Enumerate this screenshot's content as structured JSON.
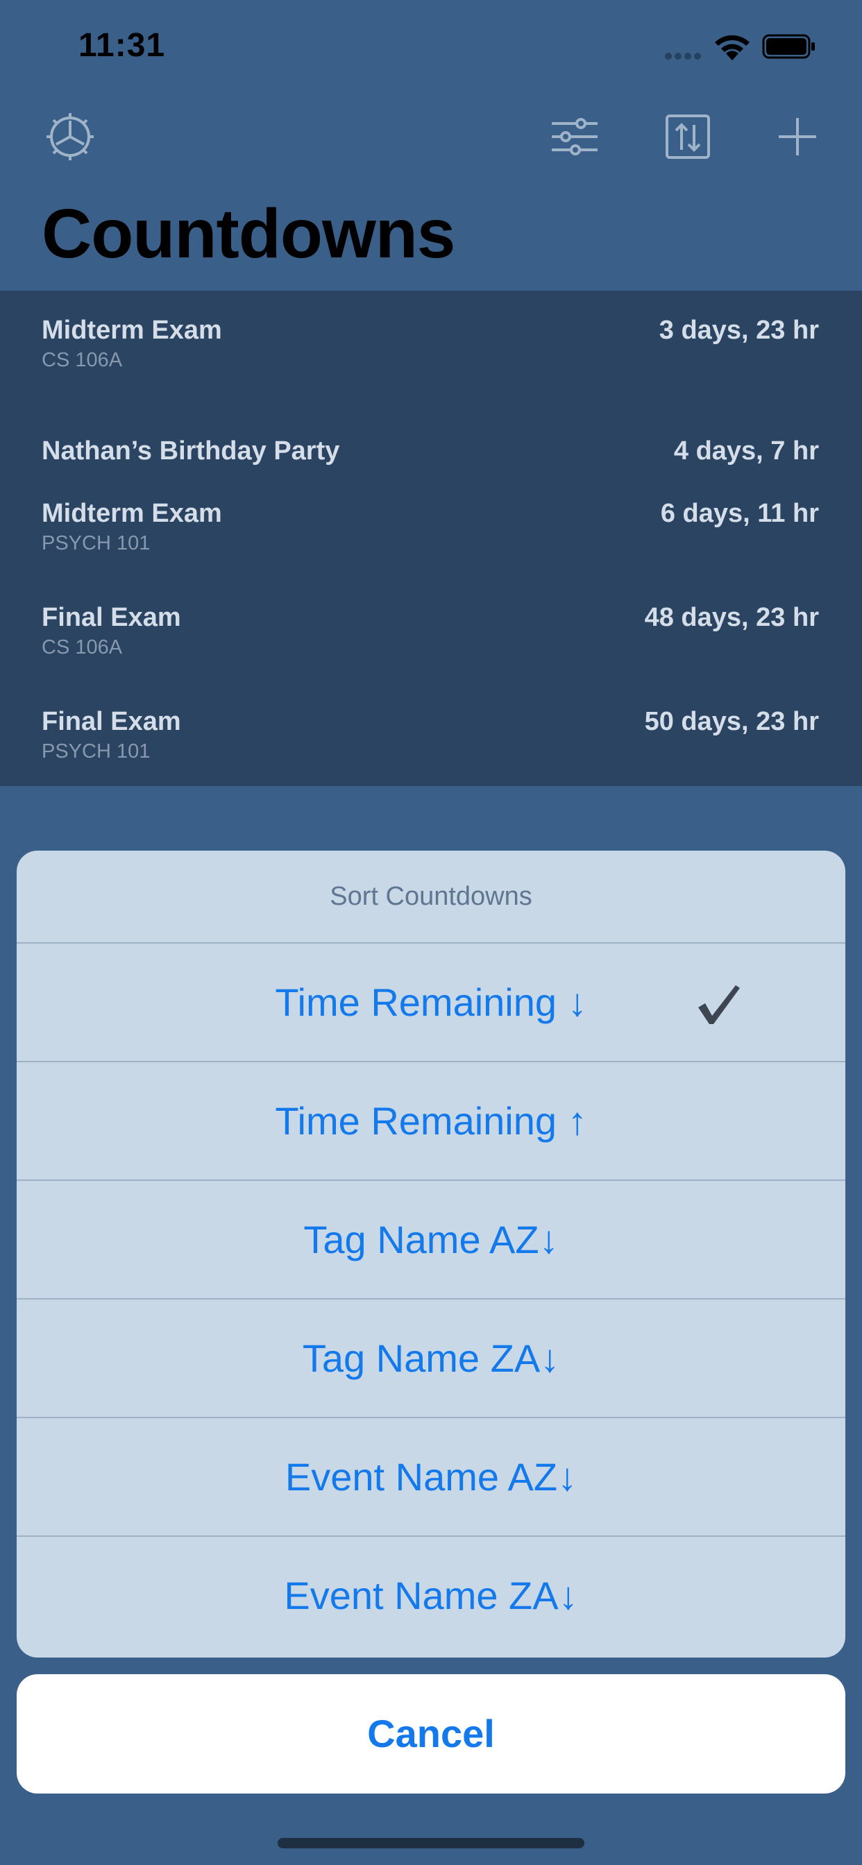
{
  "status_bar": {
    "time": "11:31"
  },
  "page_title": "Countdowns",
  "countdowns": [
    {
      "title": "Midterm Exam",
      "tag": "CS 106A",
      "time": "3 days, 23 hr"
    },
    {
      "title": "Nathan’s Birthday Party",
      "tag": "",
      "time": "4 days, 7 hr"
    },
    {
      "title": "Midterm Exam",
      "tag": "PSYCH 101",
      "time": "6 days, 11 hr"
    },
    {
      "title": "Final Exam",
      "tag": "CS 106A",
      "time": "48 days, 23 hr"
    },
    {
      "title": "Final Exam",
      "tag": "PSYCH 101",
      "time": "50 days, 23 hr"
    }
  ],
  "sort_sheet": {
    "title": "Sort Countdowns",
    "options": [
      {
        "label": "Time Remaining ↓",
        "selected": true
      },
      {
        "label": "Time Remaining ↑",
        "selected": false
      },
      {
        "label": "Tag Name AZ↓",
        "selected": false
      },
      {
        "label": "Tag Name ZA↓",
        "selected": false
      },
      {
        "label": "Event Name AZ↓",
        "selected": false
      },
      {
        "label": "Event Name ZA↓",
        "selected": false
      }
    ],
    "cancel_label": "Cancel"
  },
  "icons": {
    "settings": "gear-icon",
    "filter": "sliders-icon",
    "sort": "sort-icon",
    "add": "plus-icon",
    "selected": "checkmark-icon"
  },
  "colors": {
    "background": "#3a5f88",
    "list_background": "#2a4462",
    "sheet_background": "#c9d8e7",
    "accent": "#1479ea"
  }
}
